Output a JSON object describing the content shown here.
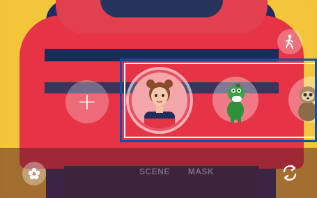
{
  "modes": [
    {
      "label": "SCENE"
    },
    {
      "label": "MASK"
    }
  ],
  "icons": {
    "add": "plus-icon",
    "body_toggle": "walking-figure-icon",
    "stickers": "flower-sticker-icon",
    "switch_camera": "rotate-camera-icon"
  },
  "avatars": [
    {
      "name": "my-emoji-girl",
      "selected": true
    },
    {
      "name": "dinosaur-emoji",
      "selected": false
    },
    {
      "name": "sloth-emoji",
      "selected": false
    }
  ],
  "colors": {
    "highlight_border": "#0f52a5",
    "sweater_red": "#e63346",
    "sweater_navy": "#1e2b58",
    "background_yellow": "#f1c437"
  }
}
